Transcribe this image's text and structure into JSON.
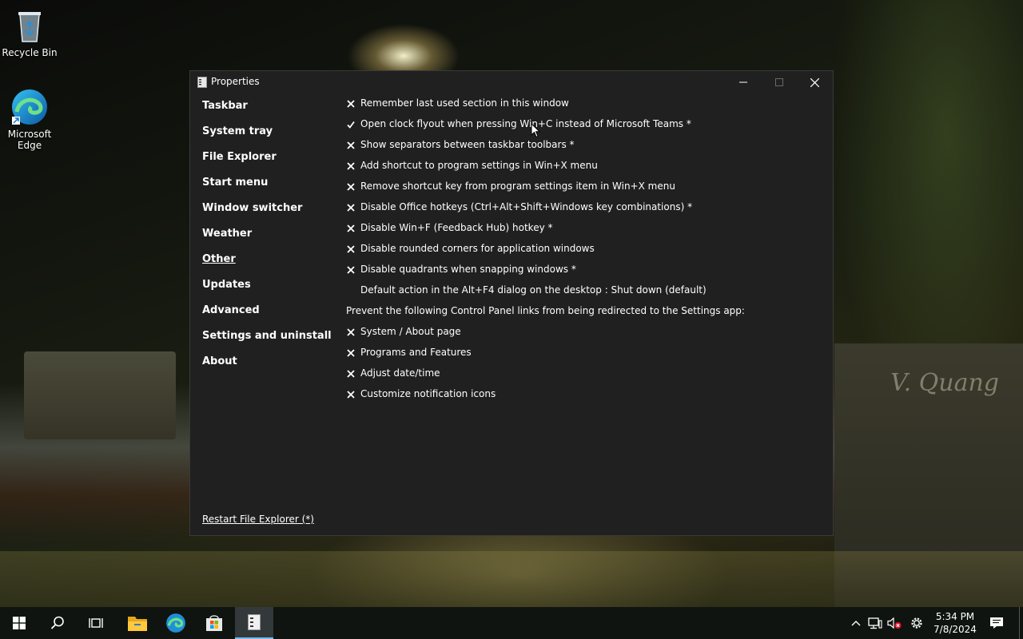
{
  "desktop": {
    "icons": [
      {
        "label": "Recycle Bin"
      },
      {
        "label": "Microsoft Edge"
      }
    ],
    "background_sign": "V. Quang"
  },
  "window": {
    "title": "Properties",
    "sidebar": {
      "items": [
        {
          "label": "Taskbar"
        },
        {
          "label": "System tray"
        },
        {
          "label": "File Explorer"
        },
        {
          "label": "Start menu"
        },
        {
          "label": "Window switcher"
        },
        {
          "label": "Weather"
        },
        {
          "label": "Other",
          "active": true
        },
        {
          "label": "Updates"
        },
        {
          "label": "Advanced"
        },
        {
          "label": "Settings and uninstall"
        },
        {
          "label": "About"
        }
      ],
      "restart_label": "Restart File Explorer (*)"
    },
    "options": [
      {
        "state": "off",
        "label": "Remember last used section in this window"
      },
      {
        "state": "on",
        "label": "Open clock flyout when pressing Win+C instead of Microsoft Teams *"
      },
      {
        "state": "off",
        "label": "Show separators between taskbar toolbars *"
      },
      {
        "state": "off",
        "label": "Add shortcut to program settings in Win+X menu"
      },
      {
        "state": "off",
        "label": "Remove shortcut key from program settings item in Win+X menu"
      },
      {
        "state": "off",
        "label": "Disable Office hotkeys (Ctrl+Alt+Shift+Windows key combinations) *"
      },
      {
        "state": "off",
        "label": "Disable Win+F (Feedback Hub) hotkey *"
      },
      {
        "state": "off",
        "label": "Disable rounded corners for application windows"
      },
      {
        "state": "off",
        "label": "Disable quadrants when snapping windows *"
      },
      {
        "state": "none",
        "label": "Default action in the Alt+F4 dialog on the desktop : Shut down (default)"
      },
      {
        "state": "heading",
        "label": "Prevent the following Control Panel links from being redirected to the Settings app:"
      },
      {
        "state": "off",
        "label": "System / About page"
      },
      {
        "state": "off",
        "label": "Programs and Features"
      },
      {
        "state": "off",
        "label": "Adjust date/time"
      },
      {
        "state": "off",
        "label": "Customize notification icons"
      }
    ]
  },
  "taskbar": {
    "buttons": [
      "start-icon",
      "search-icon",
      "task-view-icon",
      "file-explorer-icon",
      "edge-icon",
      "store-icon",
      "properties-app-icon"
    ],
    "active_button": "properties-app-icon",
    "tray": [
      "chevron-up-icon",
      "network-icon",
      "volume-muted-icon",
      "gear-icon"
    ],
    "clock": {
      "time": "5:34 PM",
      "date": "7/8/2024"
    }
  },
  "colors": {
    "window_bg": "#202020",
    "taskbar_bg": "#0f1411",
    "accent": "#76b9ed"
  }
}
